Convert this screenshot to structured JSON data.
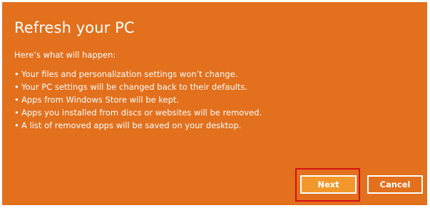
{
  "dialog": {
    "title": "Refresh your PC",
    "intro": "Here’s what will happen:",
    "bullets": [
      "Your files and personalization settings won’t change.",
      "Your PC settings will be changed back to their defaults.",
      "Apps from Windows Store will be kept.",
      "Apps you installed from discs or websites will be removed.",
      "A list of removed apps will be saved on your desktop."
    ],
    "bullet_glyph": "•"
  },
  "buttons": {
    "next_label": "Next",
    "cancel_label": "Cancel"
  },
  "colors": {
    "background": "#e2701d",
    "next_button": "#f2972b",
    "highlight": "#d7101a",
    "text": "#ffffff"
  }
}
